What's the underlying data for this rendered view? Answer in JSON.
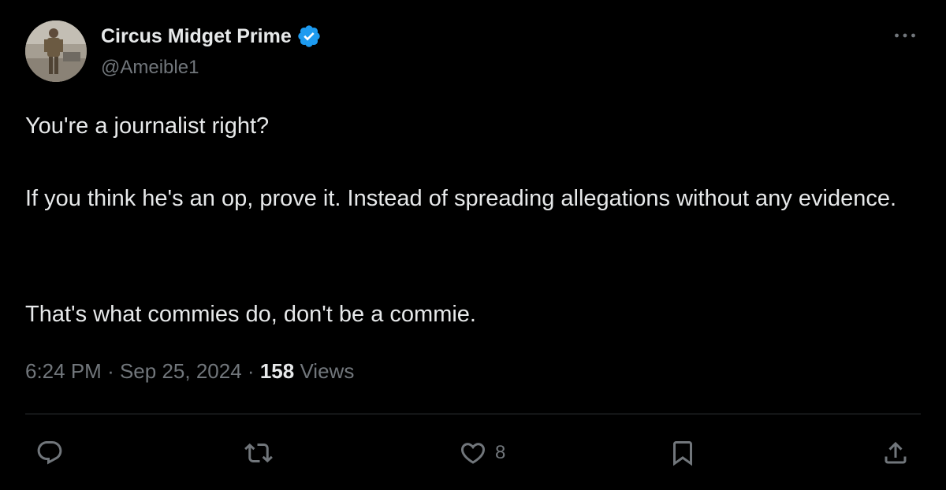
{
  "author": {
    "display_name": "Circus Midget Prime",
    "handle": "@Ameible1",
    "verified": true
  },
  "tweet": {
    "paragraphs": [
      "You're a journalist right?",
      "If you think he's an op, prove it. Instead of spreading allegations without any evidence.",
      "That's what commies do, don't be a commie."
    ],
    "time": "6:24 PM",
    "separator": "·",
    "date": "Sep 25, 2024",
    "views_count": "158",
    "views_label": "Views"
  },
  "actions": {
    "reply_count": "",
    "retweet_count": "",
    "like_count": "8",
    "bookmark_count": ""
  },
  "icons": {
    "verified": "verified-badge-icon",
    "more": "more-options-icon",
    "reply": "reply-icon",
    "retweet": "retweet-icon",
    "like": "heart-icon",
    "bookmark": "bookmark-icon",
    "share": "share-icon"
  },
  "colors": {
    "background": "#000000",
    "primary_text": "#e7e9ea",
    "secondary_text": "#71767b",
    "verified_blue": "#1d9bf0",
    "divider": "#2f3336"
  }
}
